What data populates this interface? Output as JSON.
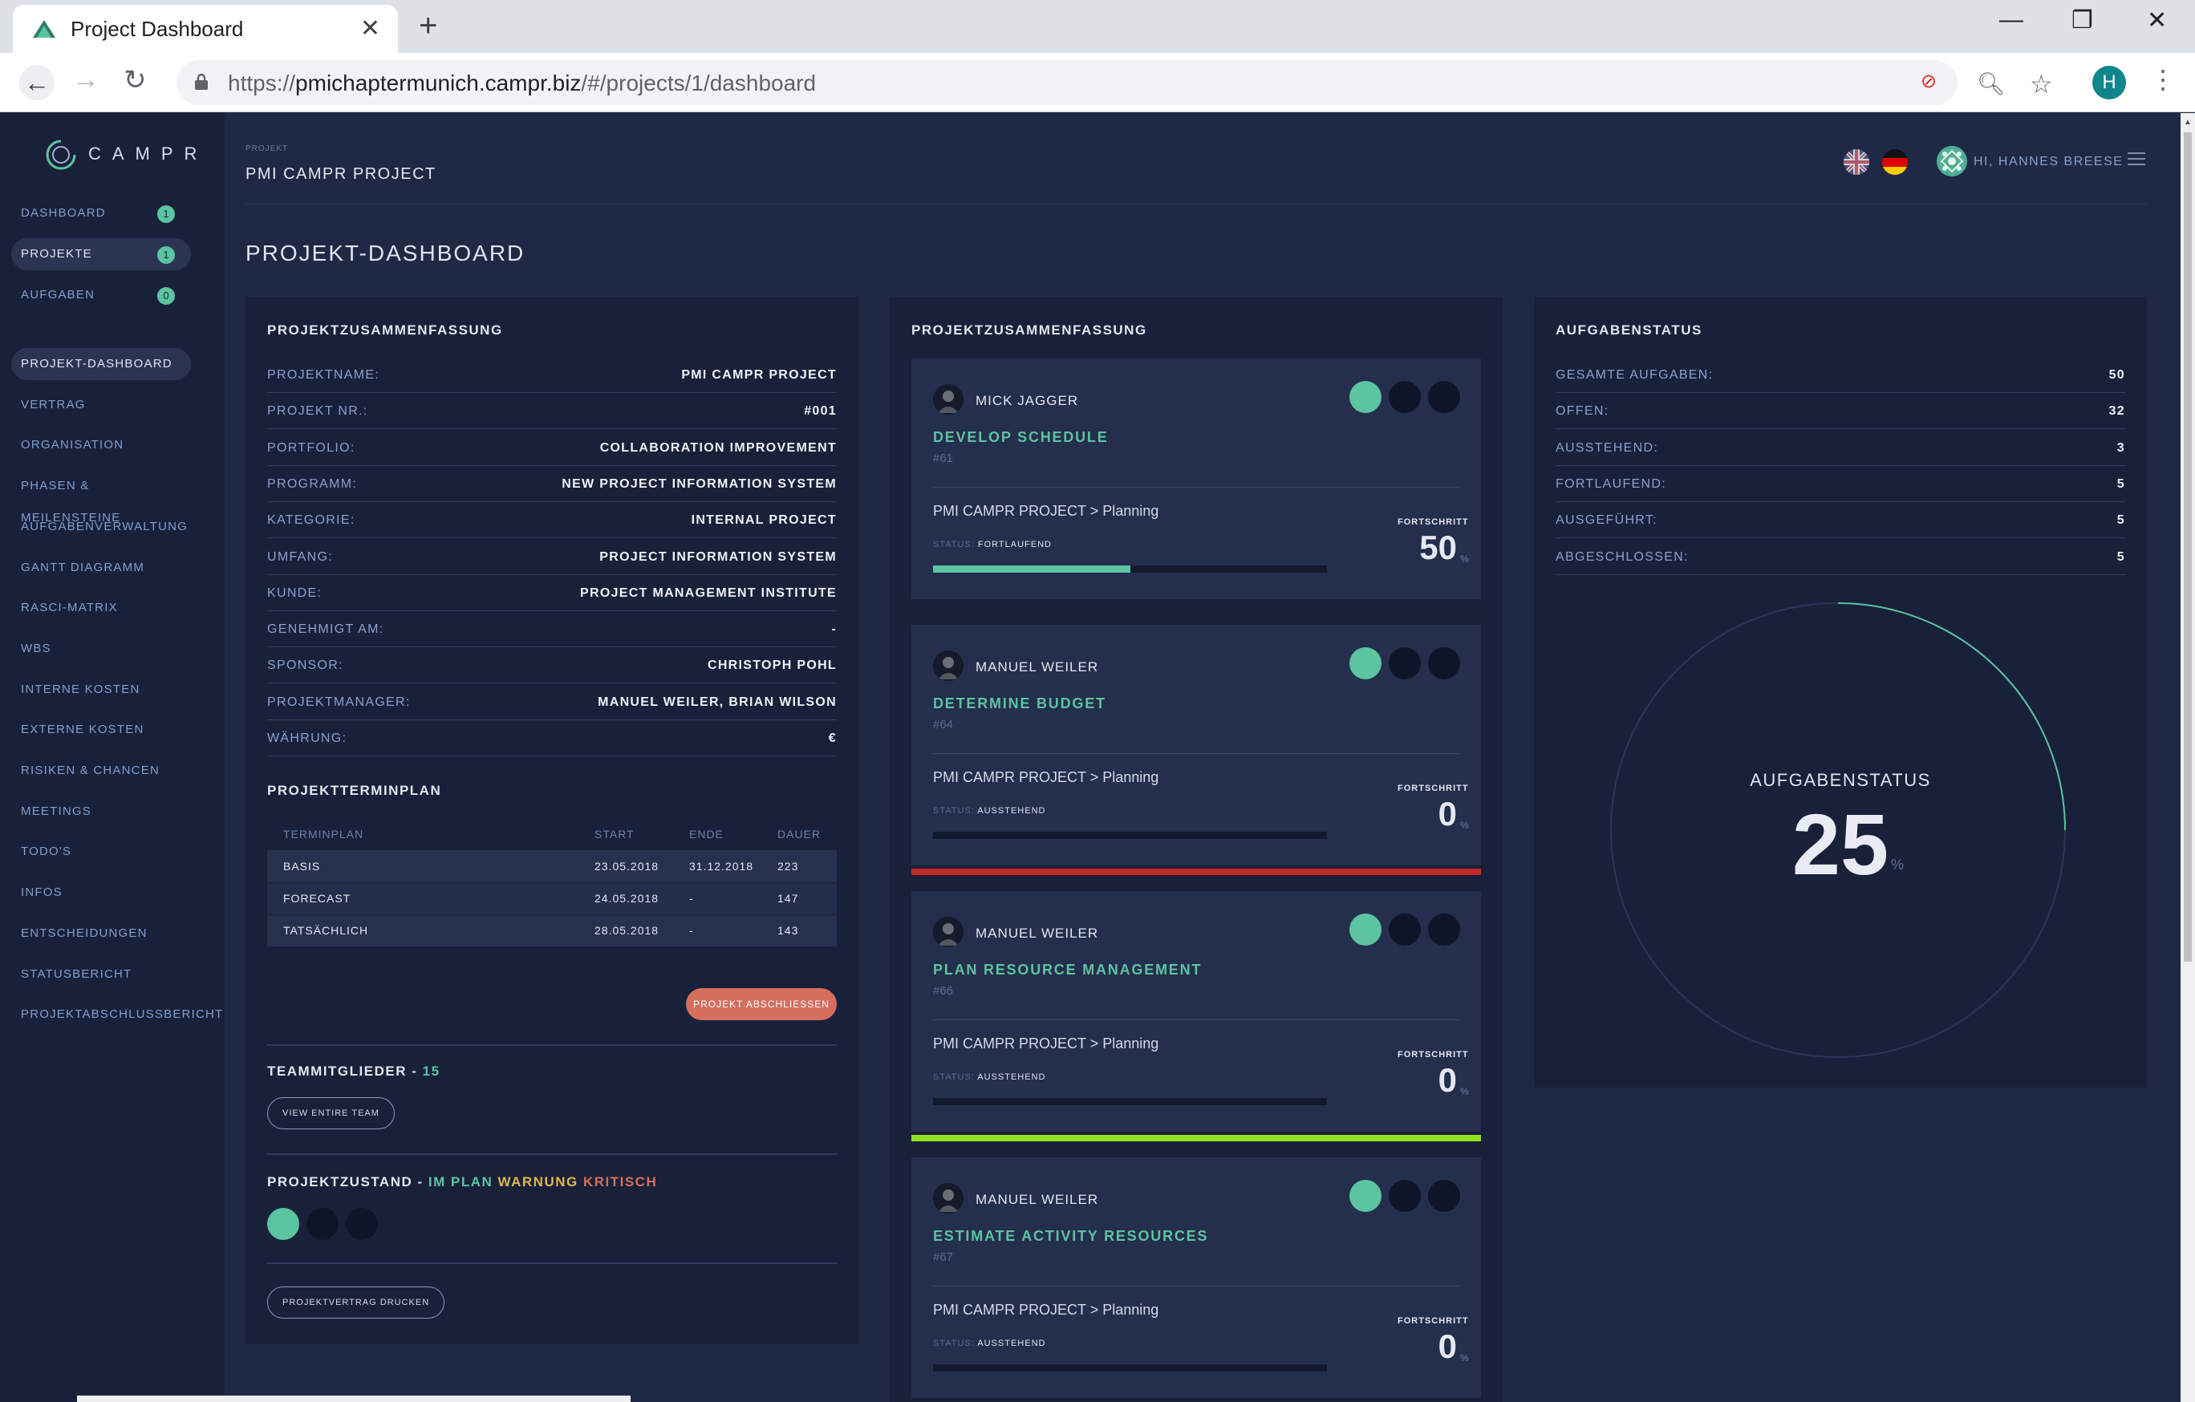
{
  "browser": {
    "tab_title": "Project Dashboard",
    "url_prefix": "https://",
    "url_host": "pmichaptermunich.campr.biz",
    "url_path": "/#/projects/1/dashboard",
    "profile_initial": "H"
  },
  "sidebar": {
    "logo_text": "CAMPR",
    "main_items": [
      {
        "label": "DASHBOARD",
        "badge": "1"
      },
      {
        "label": "PROJEKTE",
        "badge": "1"
      },
      {
        "label": "AUFGABEN",
        "badge": "0"
      }
    ],
    "project_items": [
      "PROJEKT-DASHBOARD",
      "VERTRAG",
      "ORGANISATION",
      "PHASEN & MEILENSTEINE",
      "AUFGABENVERWALTUNG",
      "GANTT DIAGRAMM",
      "RASCI-MATRIX",
      "WBS",
      "INTERNE KOSTEN",
      "EXTERNE KOSTEN",
      "RISIKEN & CHANCEN",
      "MEETINGS",
      "TODO'S",
      "INFOS",
      "ENTSCHEIDUNGEN",
      "STATUSBERICHT",
      "PROJEKTABSCHLUSSBERICHT"
    ]
  },
  "header": {
    "crumb": "PROJEKT",
    "project_title": "PMI CAMPR PROJECT",
    "greeting": "HI, HANNES BREESE"
  },
  "page_title": "PROJEKT-DASHBOARD",
  "summary": {
    "title": "PROJEKTZUSAMMENFASSUNG",
    "rows": [
      {
        "label": "PROJEKTNAME:",
        "value": "PMI CAMPR PROJECT"
      },
      {
        "label": "PROJEKT NR.:",
        "value": "#001"
      },
      {
        "label": "PORTFOLIO:",
        "value": "COLLABORATION IMPROVEMENT"
      },
      {
        "label": "PROGRAMM:",
        "value": "NEW PROJECT INFORMATION SYSTEM"
      },
      {
        "label": "KATEGORIE:",
        "value": "INTERNAL PROJECT"
      },
      {
        "label": "UMFANG:",
        "value": "PROJECT INFORMATION SYSTEM"
      },
      {
        "label": "KUNDE:",
        "value": "PROJECT MANAGEMENT INSTITUTE"
      },
      {
        "label": "GENEHMIGT AM:",
        "value": "-"
      },
      {
        "label": "SPONSOR:",
        "value": "CHRISTOPH POHL"
      },
      {
        "label": "PROJEKTMANAGER:",
        "value": "MANUEL WEILER,  BRIAN WILSON"
      },
      {
        "label": "WÄHRUNG:",
        "value": "€"
      }
    ],
    "schedule_title": "PROJEKTTERMINPLAN",
    "schedule_headers": [
      "TERMINPLAN",
      "START",
      "ENDE",
      "DAUER"
    ],
    "schedule_rows": [
      [
        "BASIS",
        "23.05.2018",
        "31.12.2018",
        "223"
      ],
      [
        "FORECAST",
        "24.05.2018",
        "-",
        "147"
      ],
      [
        "TATSÄCHLICH",
        "28.05.2018",
        "-",
        "143"
      ]
    ],
    "close_button": "PROJEKT ABSCHLIESSEN",
    "team_label": "TEAMMITGLIEDER -",
    "team_count": "15",
    "view_team_button": "VIEW ENTIRE TEAM",
    "health_label": "PROJEKTZUSTAND -",
    "health_ok": "IM PLAN",
    "health_warn": "WARNUNG",
    "health_crit": "KRITISCH",
    "print_button": "PROJEKTVERTRAG DRUCKEN"
  },
  "tasks": {
    "title": "PROJEKTZUSAMMENFASSUNG",
    "progress_label": "FORTSCHRITT",
    "status_prefix": "STATUS:",
    "cards": [
      {
        "owner": "MICK JAGGER",
        "task": "DEVELOP SCHEDULE",
        "id": "#61",
        "path": "PMI CAMPR PROJECT > Planning",
        "status": "FORTLAUFEND",
        "progress": 50,
        "progress_text": "50",
        "unit": "%",
        "accent": "",
        "accent_color": "#19213a"
      },
      {
        "owner": "MANUEL WEILER",
        "task": "DETERMINE BUDGET",
        "id": "#64",
        "path": "PMI CAMPR PROJECT > Planning",
        "status": "AUSSTEHEND",
        "progress": 0,
        "progress_text": "0",
        "unit": "%",
        "accent_color": "#c62828"
      },
      {
        "owner": "MANUEL WEILER",
        "task": "PLAN RESOURCE MANAGEMENT",
        "id": "#66",
        "path": "PMI CAMPR PROJECT > Planning",
        "status": "AUSSTEHEND",
        "progress": 0,
        "progress_text": "0",
        "unit": "%",
        "accent_color": "#8fe01e"
      },
      {
        "owner": "MANUEL WEILER",
        "task": "ESTIMATE ACTIVITY RESOURCES",
        "id": "#67",
        "path": "PMI CAMPR PROJECT > Planning",
        "status": "AUSSTEHEND",
        "progress": 0,
        "progress_text": "0",
        "unit": "%",
        "accent_color": "#19213a"
      }
    ]
  },
  "status": {
    "title": "AUFGABENSTATUS",
    "rows": [
      {
        "label": "GESAMTE AUFGABEN:",
        "value": "50"
      },
      {
        "label": "OFFEN:",
        "value": "32"
      },
      {
        "label": "AUSSTEHEND:",
        "value": "3"
      },
      {
        "label": "FORTLAUFEND:",
        "value": "5"
      },
      {
        "label": "AUSGEFÜHRT:",
        "value": "5"
      },
      {
        "label": "ABGESCHLOSSEN:",
        "value": "5"
      }
    ],
    "gauge_label": "AUFGABENSTATUS",
    "gauge_value": "25",
    "gauge_percent": 25,
    "gauge_unit": "%"
  },
  "colors": {
    "accent": "#5bc4a0",
    "warning": "#e0b74b",
    "critical": "#d46f5f",
    "background": "#1f2945",
    "panel": "#19213a"
  }
}
